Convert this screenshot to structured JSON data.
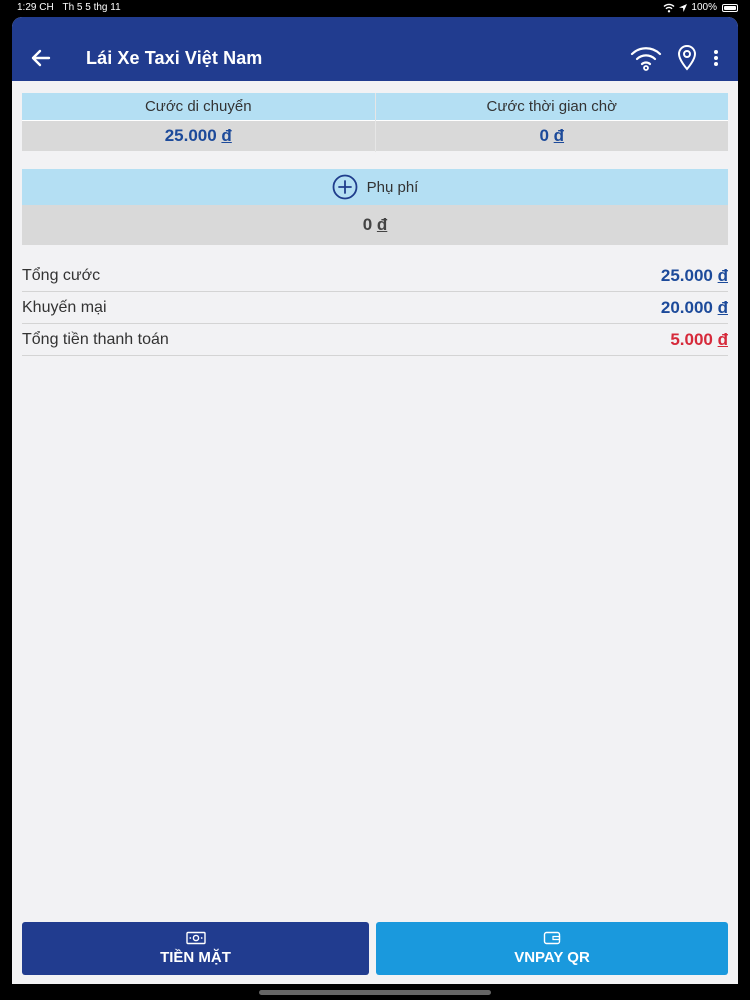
{
  "status_bar": {
    "time": "1:29 CH",
    "date": "Th 5 5 thg 11",
    "battery_label": "100%",
    "battery_level": 1.0
  },
  "app_bar": {
    "title": "Lái Xe Taxi Việt Nam",
    "icons": [
      "back-arrow-icon",
      "wifi-icon",
      "location-pin-icon",
      "more-vert-icon"
    ]
  },
  "fare": {
    "travel_label": "Cước di chuyển",
    "travel_amount": "25.000",
    "wait_label": "Cước thời gian chờ",
    "wait_amount": "0",
    "currency": "đ"
  },
  "surcharge": {
    "label": "Phụ phí",
    "amount": "0",
    "currency": "đ",
    "icon": "add-circle-icon"
  },
  "summary": {
    "rows": [
      {
        "label": "Tổng cước",
        "amount": "25.000",
        "currency": "đ",
        "color": "#1c4a9a"
      },
      {
        "label": "Khuyến mại",
        "amount": "20.000",
        "currency": "đ",
        "color": "#1c4a9a"
      },
      {
        "label": "Tổng tiền thanh toán",
        "amount": "5.000",
        "currency": "đ",
        "color": "#d6293a"
      }
    ]
  },
  "actions": {
    "cash_label": "TIỀN MẶT",
    "cash_icon": "cash-icon",
    "qr_label": "VNPAY QR",
    "qr_icon": "wallet-icon"
  },
  "colors": {
    "app_bar": "#213c8f",
    "header_cell": "#b4dff3",
    "value_cell": "#d9d9d9",
    "cash_button": "#213c8f",
    "qr_button": "#1a99dd"
  }
}
